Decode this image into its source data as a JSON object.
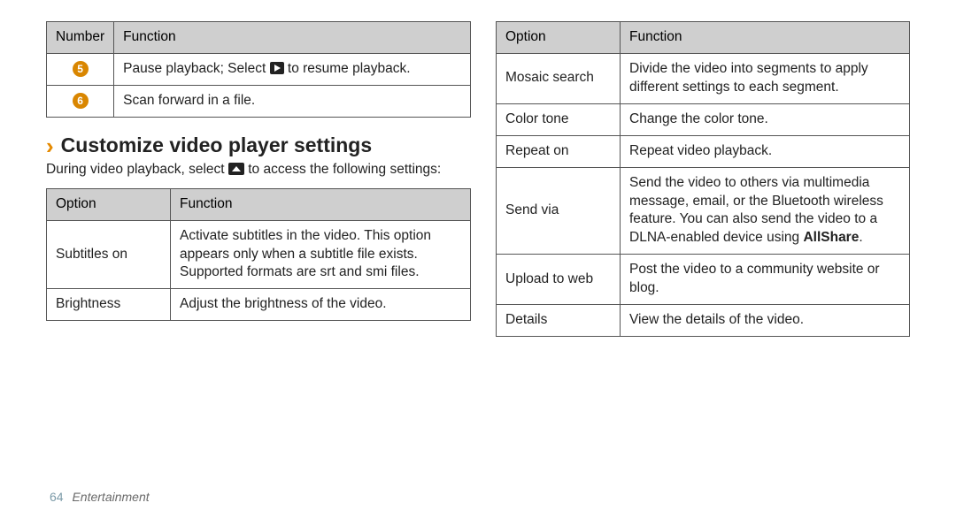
{
  "page": {
    "number": "64",
    "section": "Entertainment"
  },
  "tableA": {
    "head_number": "Number",
    "head_function": "Function",
    "rows": [
      {
        "num": "5",
        "func_pre": "Pause playback; Select ",
        "func_post": " to resume playback."
      },
      {
        "num": "6",
        "func": "Scan forward in a file."
      }
    ]
  },
  "section": {
    "chevron": "›",
    "title": "Customize video player settings",
    "lede_pre": "During video playback, select ",
    "lede_post": " to access the following settings:"
  },
  "tableB": {
    "head_option": "Option",
    "head_function": "Function",
    "rows": [
      {
        "opt": "Subtitles on",
        "func": "Activate subtitles in the video. This option appears only when a subtitle file exists. Supported formats are srt and smi files."
      },
      {
        "opt": "Brightness",
        "func": "Adjust the brightness of the video."
      }
    ]
  },
  "tableC": {
    "head_option": "Option",
    "head_function": "Function",
    "rows": [
      {
        "opt": "Mosaic search",
        "func": "Divide the video into segments to apply different settings to each segment."
      },
      {
        "opt": "Color tone",
        "func": "Change the color tone."
      },
      {
        "opt": "Repeat on",
        "func": "Repeat video playback."
      },
      {
        "opt": "Send via",
        "func_pre": "Send the video to others via multimedia message, email, or the Bluetooth wireless feature. You can also send the video to a DLNA-enabled device using ",
        "bold": "AllShare",
        "func_post": "."
      },
      {
        "opt": "Upload to web",
        "func": "Post the video to a community website or blog."
      },
      {
        "opt": "Details",
        "func": "View the details of the video."
      }
    ]
  }
}
